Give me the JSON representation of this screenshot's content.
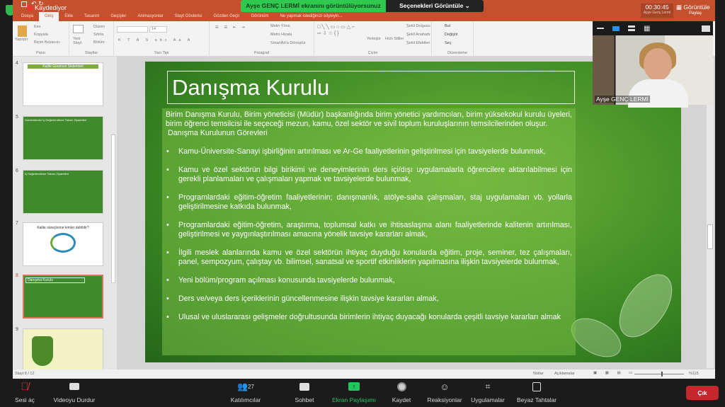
{
  "ppt": {
    "saving": "Kaydediyor",
    "tabs": [
      "Dosya",
      "Giriş",
      "Ekle",
      "Tasarım",
      "Geçişler",
      "Animasyonlar",
      "Slayt Gösterisi",
      "Gözden Geçir",
      "Görünüm"
    ],
    "tell_me": "Ne yapmak istediğinizi söyleyin...",
    "ribbon": {
      "paste": "Yapıştır",
      "cut": "Kes",
      "copy": "Kopyala",
      "format_painter": "Biçim Boyacısı",
      "pano": "Pano",
      "new_slide": "Yeni Slayt",
      "layout": "Düzen",
      "reset": "Sıfırla",
      "section": "Bölüm",
      "slides": "Slaytlar",
      "font_size": "14",
      "font": "Yazı Tipi",
      "text_dir": "Metin Yönü",
      "align_text": "Metni Hizala",
      "smartart": "SmartArt'a Dönüştür",
      "paragraph": "Paragraf",
      "arrange": "Yerleştir",
      "quick_styles": "Hızlı Stiller",
      "shape_fill": "Şekil Dolgusu",
      "shape_outline": "Şekil Anahattı",
      "shape_effects": "Şekil Efektleri",
      "drawing": "Çizim",
      "find": "Bul",
      "replace": "Değiştir",
      "select": "Seç",
      "editing": "Düzenleme"
    },
    "thumbnails": [
      {
        "num": "4",
        "title": "Kalite Güvence Sistemleri"
      },
      {
        "num": "5",
        "title": "Üniversitemiz İç Değerlendirme Takımı Ziyaretleri"
      },
      {
        "num": "6",
        "title": "İç Değerlendirme Takımı Ziyaretleri"
      },
      {
        "num": "7",
        "title": "Kalite süreçlerine kimler dahildir?"
      },
      {
        "num": "8",
        "title": "Danışma Kurulu"
      },
      {
        "num": "9",
        "title": ""
      }
    ],
    "status": {
      "slide": "Slayt 8 / 12",
      "notes": "Notlar",
      "comments": "Açıklamalar",
      "zoom": "%115"
    }
  },
  "slide": {
    "title": "Danışma Kurulu",
    "intro": "Birim Danışma Kurulu, Birim yöneticisi (Müdür) başkanlığında birim yönetici yardımcıları, birim yüksekokul kurulu üyeleri, birim öğrenci temsilcisi ile seçeceği mezun, kamu, özel sektör ve sivil toplum kuruluşlarının temsilcilerinden oluşur.",
    "subtitle": "Danışma Kurulunun Görevleri",
    "bullets": [
      "Kamu-Üniversite-Sanayi işbirliğinin artırılması ve Ar-Ge faaliyetlerinin geliştirilmesi için tavsiyelerde bulunmak,",
      "Kamu ve özel sektörün bilgi birikimi ve deneyimlerinin ders içi/dışı uygulamalarla öğrencilere aktarılabilmesi için gerekli planlamaları ve çalışmaları yapmak ve tavsiyelerde bulunmak,",
      "Programlardaki eğitim-öğretim faaliyetlerinin; danışmanlık, atölye-saha çalışmaları, staj uygulamaları vb. yollarla geliştirilmesine katkıda bulunmak,",
      "Programlardaki eğitim-öğretim, araştırma, toplumsal katkı ve ihtisaslaşma alanı faaliyetlerinde kalitenin artırılması, geliştirilmesi ve yaygınlaştırılması amacına yönelik tavsiye kararları almak,",
      "İlgili meslek alanlarında kamu ve özel sektörün ihtiyaç duyduğu konularda eğitim, proje, seminer, tez çalışmaları, panel, sempozyum, çalıştay vb. bilimsel, sanatsal ve sportif etkinliklerin yapılmasına ilişkin tavsiyelerde bulunmak,",
      "Yeni bölüm/program açılması konusunda tavsiyelerde bulunmak,",
      "Ders ve/veya ders içeriklerinin güncellenmesine ilişkin tavsiye kararları almak,",
      "Ulusal ve uluslararası gelişmeler doğrultusunda birimlerin ihtiyaç duyacağı konularda çeşitli tavsiye kararları almak"
    ]
  },
  "zoom": {
    "banner": "Ayşe GENÇ LERMİ ekranını görüntülüyorsunuz",
    "options": "Seçenekleri Görüntüle",
    "timer": "00:30:45",
    "host_small": "Ayşe Genç Lermi",
    "view": "Görüntüle",
    "share_small": "Paylaş",
    "video_name": "Ayşe GENÇ LERMİ",
    "participant_count": "27",
    "toolbar": {
      "mute": "Sesi aç",
      "video": "Videoyu Durdur",
      "participants": "Katılımcılar",
      "chat": "Sohbet",
      "share": "Ekran Paylaşımı",
      "record": "Kaydet",
      "reactions": "Reaksiyonlar",
      "apps": "Uygulamalar",
      "whiteboard": "Beyaz Tahtalar",
      "leave": "Çık"
    },
    "colors": {
      "share_green": "#22c55e",
      "leave_red": "#c4282d",
      "ppt_orange": "#c4502d"
    }
  }
}
